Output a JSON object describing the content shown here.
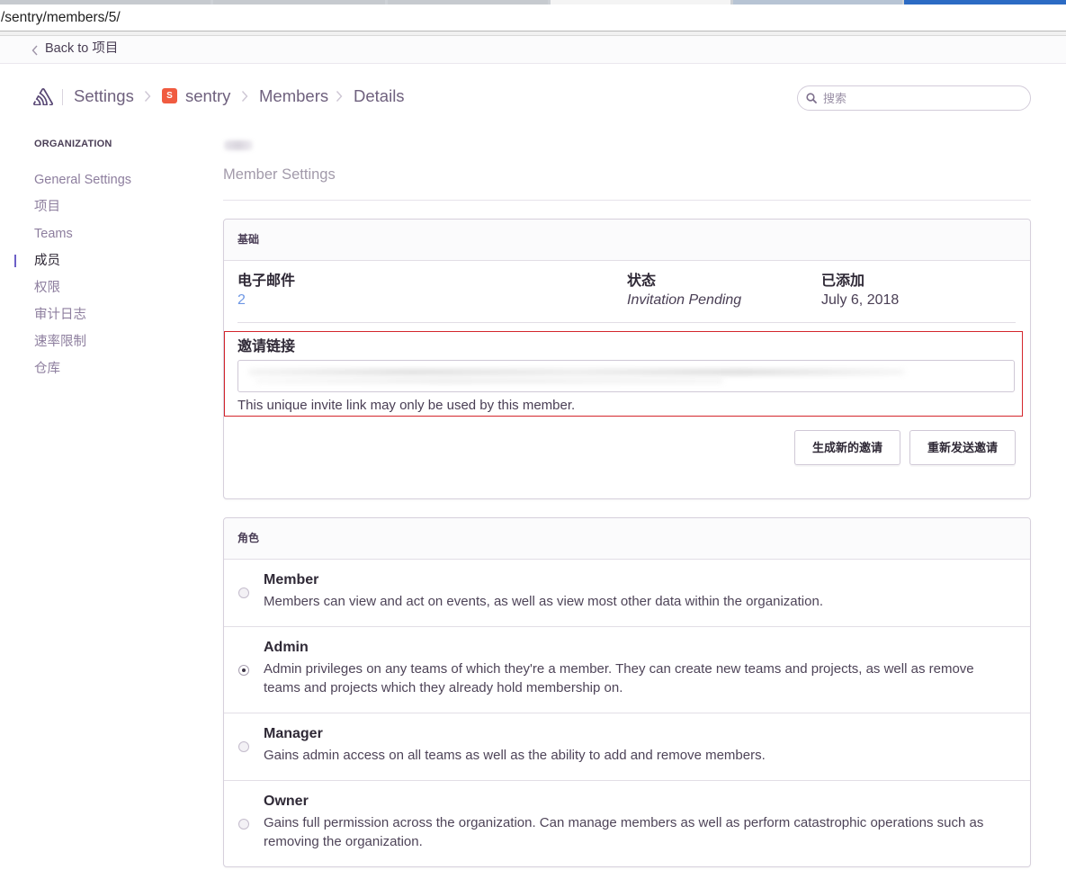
{
  "browser": {
    "url": "/sentry/members/5/"
  },
  "back_link": {
    "label": "Back to 项目"
  },
  "breadcrumb": {
    "settings": "Settings",
    "org_badge": "S",
    "org": "sentry",
    "members": "Members",
    "details": "Details"
  },
  "search": {
    "placeholder": "搜索"
  },
  "sidebar": {
    "heading": "ORGANIZATION",
    "items": [
      {
        "label": "General Settings",
        "active": false
      },
      {
        "label": "项目",
        "active": false
      },
      {
        "label": "Teams",
        "active": false
      },
      {
        "label": "成员",
        "active": true
      },
      {
        "label": "权限",
        "active": false
      },
      {
        "label": "审计日志",
        "active": false
      },
      {
        "label": "速率限制",
        "active": false
      },
      {
        "label": "仓库",
        "active": false
      }
    ]
  },
  "page": {
    "title": "Member Settings"
  },
  "basics": {
    "header": "基础",
    "email": {
      "label": "电子邮件",
      "value": "2"
    },
    "status": {
      "label": "状态",
      "value": "Invitation Pending"
    },
    "added": {
      "label": "已添加",
      "value": "July 6, 2018"
    },
    "invite_link": {
      "label": "邀请链接",
      "help": "This unique invite link may only be used by this member."
    },
    "buttons": {
      "regenerate": "生成新的邀请",
      "resend": "重新发送邀请"
    }
  },
  "roles": {
    "header": "角色",
    "items": [
      {
        "name": "Member",
        "description": "Members can view and act on events, as well as view most other data within the organization.",
        "selected": false
      },
      {
        "name": "Admin",
        "description": "Admin privileges on any teams of which they're a member. They can create new teams and projects, as well as remove teams and projects which they already hold membership on.",
        "selected": true
      },
      {
        "name": "Manager",
        "description": "Gains admin access on all teams as well as the ability to add and remove members.",
        "selected": false
      },
      {
        "name": "Owner",
        "description": "Gains full permission across the organization. Can manage members as well as perform catastrophic operations such as removing the organization.",
        "selected": false
      }
    ]
  },
  "icons": {
    "back": "chevron-left-icon",
    "logo": "sentry-logo-icon",
    "breadcrumb_separator": "chevron-right-icon",
    "search": "search-icon",
    "radio": "radio-icon"
  },
  "colors": {
    "accent": "#6c5fc7",
    "org_badge": "#f05b40",
    "email_link": "#3d74db",
    "annotation_border": "#d4262c"
  }
}
